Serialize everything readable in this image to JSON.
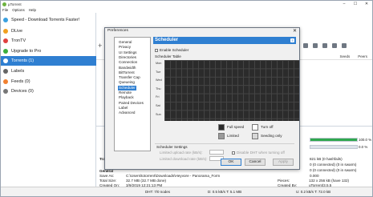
{
  "window": {
    "title": "µTorrent"
  },
  "menu": [
    "File",
    "Options",
    "Help"
  ],
  "sidebar": {
    "items": [
      {
        "label": "Speed - Download Torrents Faster!",
        "color": "#3aa0e0"
      },
      {
        "label": "DLive",
        "color": "#f0a020"
      },
      {
        "label": "TronTV",
        "color": "#e04040"
      },
      {
        "label": "Upgrade to Pro",
        "color": "#3cae3c"
      },
      {
        "label": "Torrents (1)",
        "color": "#ffffff"
      },
      {
        "label": "Labels",
        "color": "#666666"
      },
      {
        "label": "Feeds (0)",
        "color": "#f08030"
      },
      {
        "label": "Devices (0)",
        "color": "#777777"
      }
    ]
  },
  "list": {
    "col_seeds": "Seeds",
    "col_peers": "Peers"
  },
  "progress": [
    {
      "text": "100.0 %",
      "value": 1.0
    },
    {
      "text": "0.0 %",
      "value": 0.0
    }
  ],
  "details": {
    "section_transfer": "Transfer",
    "right_col": [
      "821 kB (0 hashfails)",
      "0 (0 connected) (0 in swarm)",
      "0 (0 connected) (0 in swarm)",
      "0.000"
    ],
    "section_general": "General",
    "save_as_label": "Save As:",
    "save_as_value": "C:\\Users\\totorrent\\Downloads\\Heyvore - Panorama_Form",
    "total_size_label": "Total Size:",
    "total_size_value": "32.7 MB (32.7 MB done)",
    "created_on_label": "Created On:",
    "created_on_value": "3/9/2019 12:21:13 PM",
    "pieces_label": "Pieces:",
    "pieces_value": "132 x 256 kB (have 132)",
    "created_by_label": "Created By:",
    "created_by_value": "uTorrent/3.5.5"
  },
  "statusbar": {
    "dht": "DHT: 7/0 nodes",
    "down": "D: 0.5 kB/s T: 5.1 MB",
    "up": "U: 0.2 kB/s T: 72.0 kB"
  },
  "prefs": {
    "title": "Preferences",
    "close": "✕",
    "tree": [
      "General",
      "Privacy",
      "UI Settings",
      "Directories",
      "Connection",
      "Bandwidth",
      "BitTorrent",
      "Transfer Cap",
      "Queueing",
      "Scheduler",
      "Remote",
      "Playback",
      "Paired Devices",
      "Label",
      "Advanced"
    ],
    "selected_index": 9,
    "header": "Scheduler",
    "help": "?",
    "enable_scheduler": "Enable Scheduler",
    "table_label": "Scheduler Table",
    "days": [
      "Mon",
      "Tue",
      "Wed",
      "Thu",
      "Fri",
      "Sat",
      "Sun"
    ],
    "legend": {
      "full_speed": "Full speed",
      "limited": "Limited",
      "turn_off": "Turn off",
      "seeding_only": "Seeding only"
    },
    "settings_label": "Scheduler Settings",
    "limited_upload": "Limited upload rate (kB/s):",
    "limited_download": "Limited download rate (kB/s):",
    "disable_dht": "Disable DHT when turning off",
    "ok": "OK",
    "cancel": "Cancel",
    "apply": "Apply"
  },
  "colors": {
    "accent": "#2f7fd1",
    "grid": "#2b2b2b",
    "progress": "#2fa84f"
  }
}
